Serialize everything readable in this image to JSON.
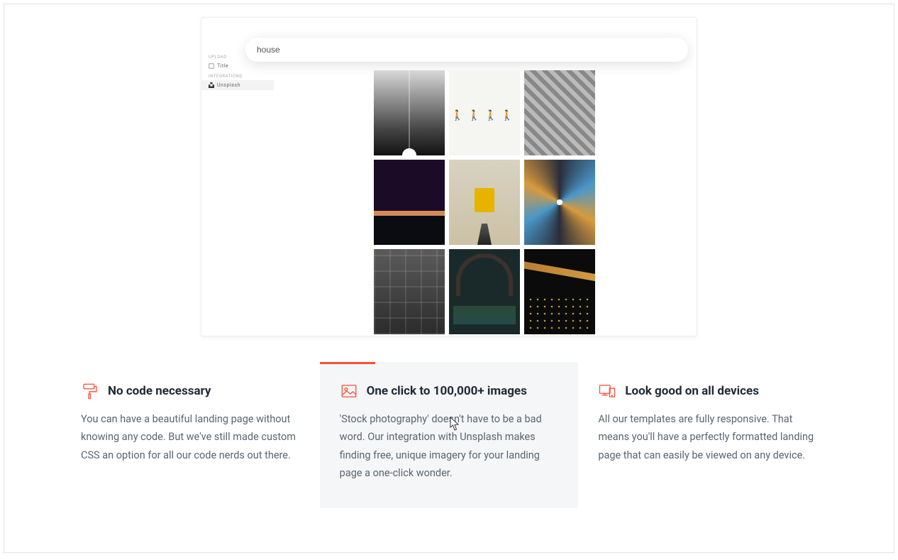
{
  "demo": {
    "search_value": "house",
    "search_placeholder": "",
    "sidebar": {
      "section_upload": "UPLOAD",
      "item_title": "Title",
      "section_integrations": "INTEGRATIONS",
      "item_unsplash": "Unsplash"
    }
  },
  "features": [
    {
      "icon": "paint-roller-icon",
      "title": "No code necessary",
      "body": "You can have a beautiful landing page without knowing any code. But we've still made custom CSS an option for all our code nerds out there."
    },
    {
      "icon": "image-icon",
      "title": "One click to 100,000+ images",
      "body": "'Stock photography' doesn't have to be a bad word. Our integration with Unsplash makes finding free, unique imagery for your landing page a one-click wonder."
    },
    {
      "icon": "devices-icon",
      "title": "Look good on all devices",
      "body": "All our templates are fully responsive. That means you'll have a perfectly formatted landing page that can easily be viewed on any device."
    }
  ]
}
